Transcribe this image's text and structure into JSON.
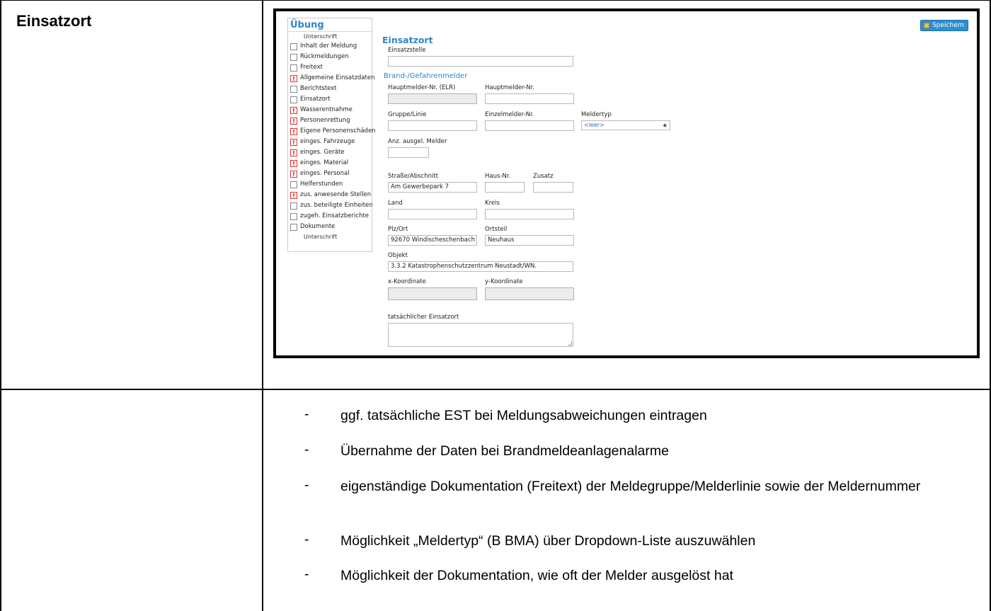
{
  "heading": "Einsatzort",
  "screenshot": {
    "save_label": "Speichern",
    "nav": {
      "title": "Übung",
      "top_label": "Unterschrift",
      "bottom_label": "Unterschrift",
      "items": [
        {
          "label": "Inhalt der Meldung",
          "warn": false
        },
        {
          "label": "Rückmeldungen",
          "warn": false
        },
        {
          "label": "Freitext",
          "warn": false
        },
        {
          "label": "Allgemeine Einsatzdaten",
          "warn": true
        },
        {
          "label": "Berichtstext",
          "warn": false
        },
        {
          "label": "Einsatzort",
          "warn": false
        },
        {
          "label": "Wasserentnahme",
          "warn": true
        },
        {
          "label": "Personenrettung",
          "warn": true
        },
        {
          "label": "Eigene Personenschäden",
          "warn": true
        },
        {
          "label": "einges. Fahrzeuge",
          "warn": true
        },
        {
          "label": "einges. Geräte",
          "warn": true
        },
        {
          "label": "einges. Material",
          "warn": true
        },
        {
          "label": "einges. Personal",
          "warn": true
        },
        {
          "label": "Helferstunden",
          "warn": false
        },
        {
          "label": "zus. anwesende Stellen",
          "warn": true
        },
        {
          "label": "zus. beteiligte Einheiten",
          "warn": false
        },
        {
          "label": "zugeh. Einsatzberichte",
          "warn": false
        },
        {
          "label": "Dokumente",
          "warn": false
        }
      ],
      "warn_glyph": "!"
    },
    "form": {
      "title": "Einsatzort",
      "einsatzstelle_label": "Einsatzstelle",
      "einsatzstelle_value": "",
      "section_melder": "Brand-/Gefahrenmelder",
      "hauptmelder_elr_label": "Hauptmelder-Nr. (ELR)",
      "hauptmelder_label": "Hauptmelder-Nr.",
      "gruppe_label": "Gruppe/Linie",
      "einzelmelder_label": "Einzelmelder-Nr.",
      "meldertyp_label": "Meldertyp",
      "meldertyp_value": "<leer>",
      "anz_label": "Anz. ausgel. Melder",
      "strasse_label": "Straße/Abschnitt",
      "strasse_value": "Am Gewerbepark 7",
      "hausnr_label": "Haus-Nr.",
      "zusatz_label": "Zusatz",
      "land_label": "Land",
      "kreis_label": "Kreis",
      "plz_label": "Plz/Ort",
      "plz_value": "92670 Windischeschenbach",
      "ortsteil_label": "Ortsteil",
      "ortsteil_value": "Neuhaus",
      "objekt_label": "Objekt",
      "objekt_value": "3.3.2 Katastrophenschutzzentrum Neustadt/WN.",
      "x_label": "x-Koordinate",
      "y_label": "y-Koordinate",
      "tatsaechlich_label": "tatsächlicher Einsatzort"
    }
  },
  "bullets": {
    "dash": "-",
    "items": [
      "ggf. tatsächliche EST bei Meldungsabweichungen eintragen",
      "Übernahme der Daten bei Brandmeldeanlagenalarme",
      "eigenständige Dokumentation (Freitext) der Meldegruppe/Melderlinie sowie der Meldernummer",
      "Möglichkeit „Meldertyp“ (B BMA) über Dropdown-Liste auszuwählen",
      "Möglichkeit der Dokumentation, wie oft der Melder ausgelöst hat"
    ]
  }
}
